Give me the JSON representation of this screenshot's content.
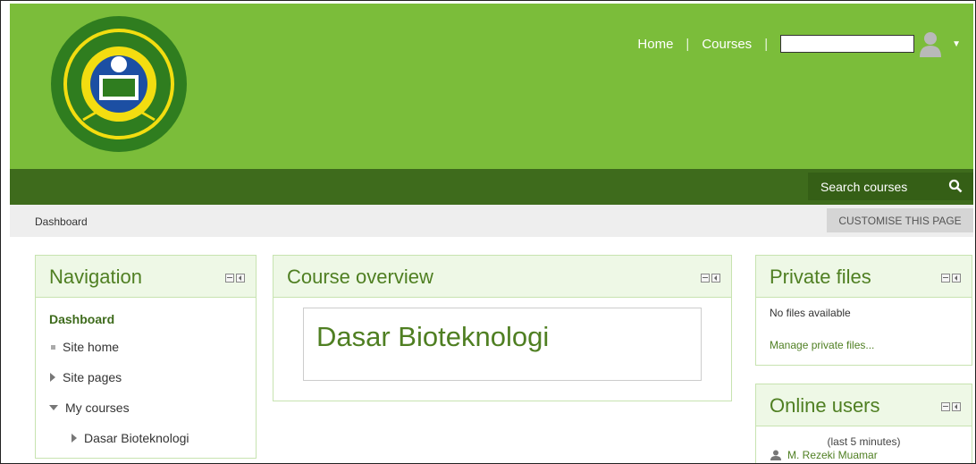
{
  "header": {
    "logo_name": "university-logo",
    "nav": {
      "home": "Home",
      "courses": "Courses"
    },
    "user_icon": "user-avatar-icon"
  },
  "searchbar": {
    "label": "Search courses",
    "icon": "search-icon"
  },
  "breadcrumb": {
    "item": "Dashboard",
    "customise": "CUSTOMISE THIS PAGE"
  },
  "navigation": {
    "title": "Navigation",
    "items": [
      {
        "label": "Dashboard"
      },
      {
        "label": "Site home"
      },
      {
        "label": "Site pages"
      },
      {
        "label": "My courses"
      },
      {
        "label": "Dasar Bioteknologi"
      }
    ]
  },
  "course_overview": {
    "title": "Course overview",
    "courses": [
      {
        "name": "Dasar Bioteknologi"
      }
    ]
  },
  "private_files": {
    "title": "Private files",
    "empty": "No files available",
    "manage": "Manage private files..."
  },
  "online_users": {
    "title": "Online users",
    "period": "(last 5 minutes)",
    "users": [
      {
        "name": "M. Rezeki Muamar"
      }
    ]
  },
  "colors": {
    "brand_green": "#7bbd3a",
    "dark_green": "#3e6b1c",
    "title_green": "#4f7f22"
  }
}
